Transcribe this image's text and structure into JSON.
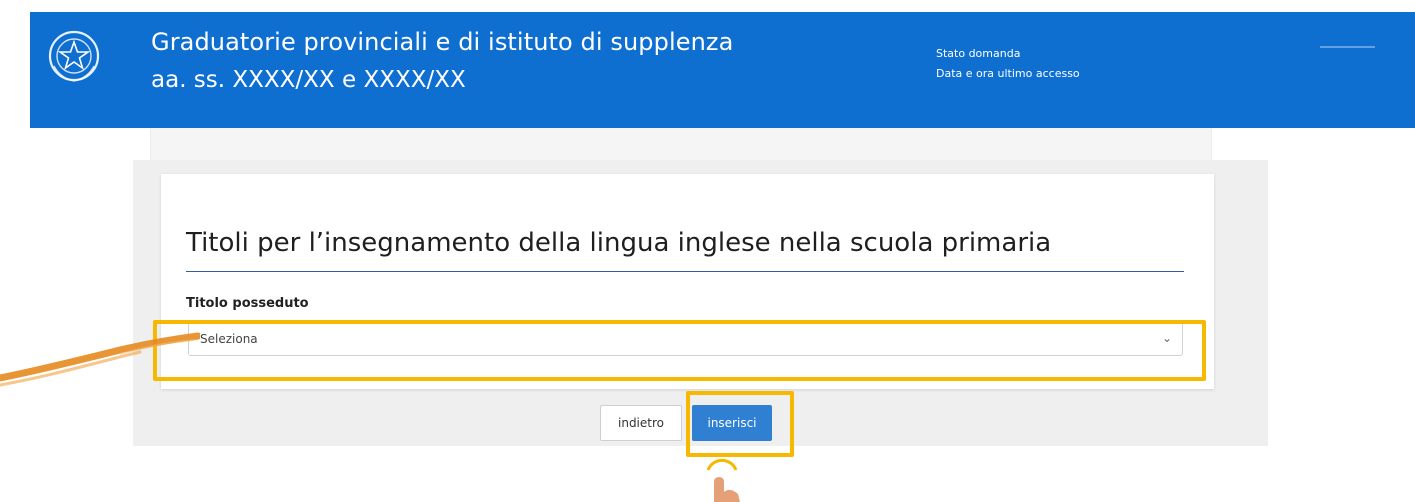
{
  "header": {
    "title_line1": "Graduatorie provinciali e di istituto di supplenza",
    "title_line2": "aa. ss.  XXXX/XX   e  XXXX/XX",
    "status_label": "Stato domanda",
    "last_access_label": "Data e ora ultimo accesso",
    "background_color": "#0f6fd1"
  },
  "form": {
    "title": "Titoli per l’insegnamento della lingua inglese nella scuola primaria",
    "field_label": "Titolo posseduto",
    "select_value": "Seleziona",
    "select_icon": "chevron-down-icon"
  },
  "buttons": {
    "back_label": "indietro",
    "insert_label": "inserisci",
    "insert_color": "#2f7fd2"
  },
  "annotations": {
    "highlight_color": "#f6b800",
    "pointer_icon": "hand-pointer-icon",
    "brush_color": "#e58a1f"
  }
}
